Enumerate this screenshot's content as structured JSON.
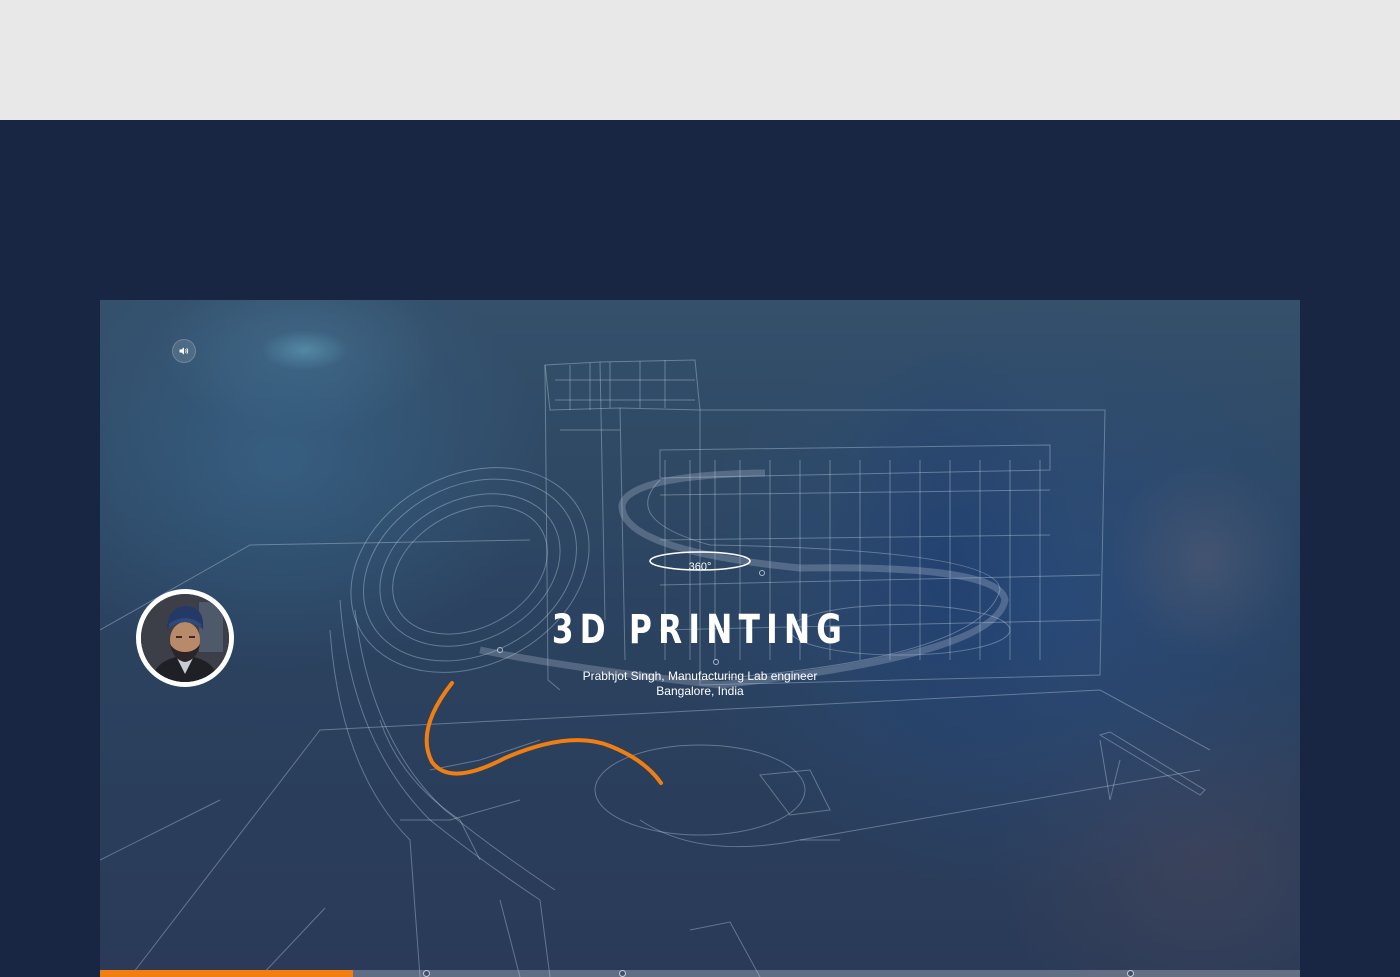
{
  "hero": {
    "badge": "360°",
    "title": "3D PRINTING",
    "subtitle_line1": "Prabhjot Singh, Manufacturing Lab engineer",
    "subtitle_line2": "Bangalore, India",
    "sound_icon": "speaker-icon",
    "accent_color": "#f07e10"
  },
  "progress": {
    "value": 0.211,
    "markers": [
      0.272,
      0.435,
      0.858
    ]
  },
  "colors": {
    "page_top": "#e8e8e8",
    "page_navy": "#192643",
    "accent": "#f07e10"
  }
}
